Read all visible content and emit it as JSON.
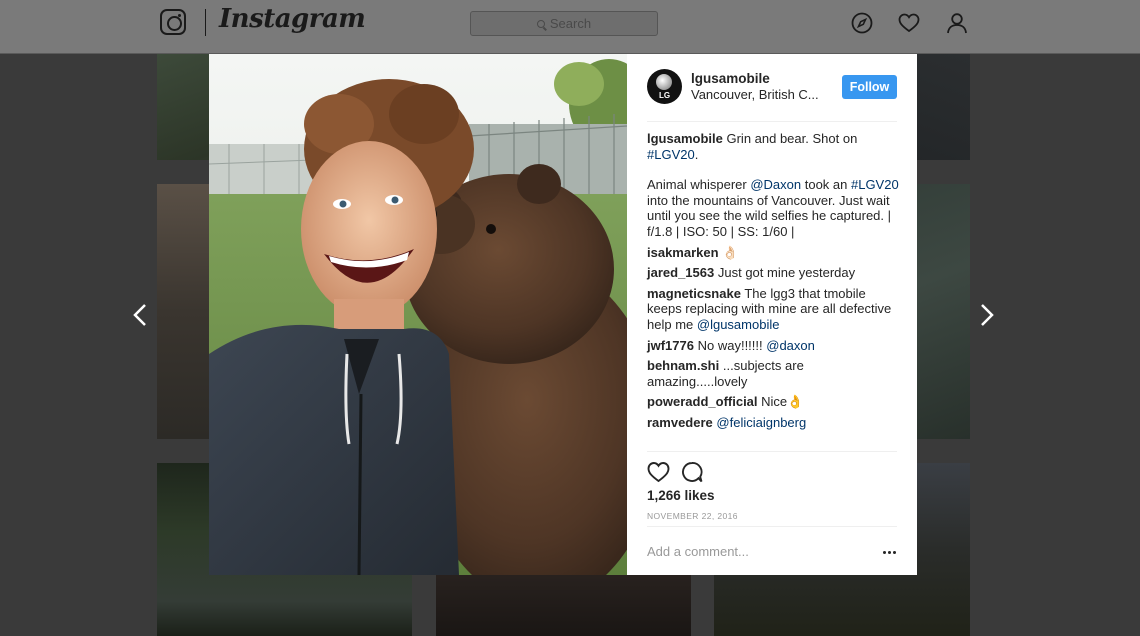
{
  "topbar": {
    "brand": "Instagram",
    "search_placeholder": "Search",
    "icons": [
      "camera-logo-icon",
      "compass-icon",
      "heart-icon",
      "user-icon"
    ]
  },
  "post": {
    "username": "lgusamobile",
    "location": "Vancouver, British C...",
    "avatar_text": "LG",
    "follow_label": "Follow",
    "caption": {
      "user": "lgusamobile",
      "text": "Grin and bear. Shot on",
      "hashtag": "#LGV20",
      "end": "."
    },
    "body": {
      "t1": "Animal whisperer ",
      "mention": "@Daxon",
      "t2": " took an ",
      "hashtag": "#LGV20",
      "t3": " into the mountains of Vancouver. Just wait until you see the wild selfies he captured. | f/1.8 | ISO: 50 | SS: 1/60 |"
    },
    "comments": [
      {
        "user": "isakmarken",
        "text": "👌🏻",
        "mention": ""
      },
      {
        "user": "jared_1563",
        "text": "Just got mine yesterday",
        "mention": ""
      },
      {
        "user": "magneticsnake",
        "text": "The lgg3 that tmobile keeps replacing with mine are all defective help me ",
        "mention": "@lgusamobile"
      },
      {
        "user": "jwf1776",
        "text": "No way!!!!!! ",
        "mention": "@daxon"
      },
      {
        "user": "behnam.shi",
        "text": "...subjects are amazing.....lovely",
        "mention": ""
      },
      {
        "user": "poweradd_official",
        "text": "Nice👌",
        "mention": ""
      },
      {
        "user": "ramvedere",
        "text": "",
        "mention": "@feliciaignberg"
      }
    ],
    "likes": "1,266 likes",
    "date": "NOVEMBER 22, 2016",
    "add_comment_placeholder": "Add a comment..."
  },
  "colors": {
    "follow_button": "#3897f0",
    "link": "#003569",
    "backdrop": "#3a3a3a"
  }
}
